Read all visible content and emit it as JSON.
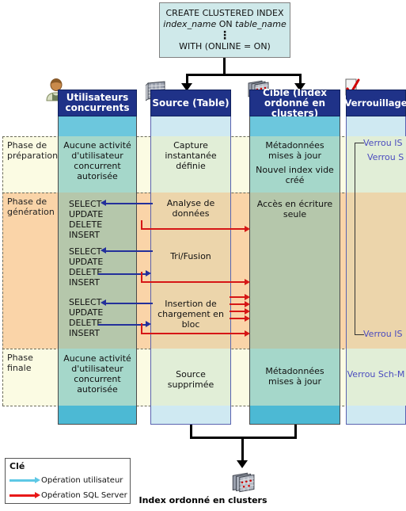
{
  "statement": {
    "line1": "CREATE CLUSTERED INDEX",
    "line2_a": "index_name",
    "line2_b": " ON ",
    "line2_c": "table_name",
    "ellipsis": "⋮",
    "line3": "WITH (ONLINE = ON)"
  },
  "columns": [
    {
      "key": "users",
      "header": "Utilisateurs\nconcurrents",
      "header_l1": "Utilisateurs",
      "header_l2": "concurrents",
      "icon": "user-icon"
    },
    {
      "key": "source",
      "header": "Source (Table)",
      "header_l1": "Source (Table)",
      "header_l2": "",
      "icon": "table-icon"
    },
    {
      "key": "target",
      "header": "Cible (Index ordonné en clusters)",
      "header_l1": "Cible (Index",
      "header_l2": "ordonné en clusters)",
      "icon": "index-icon"
    },
    {
      "key": "lock",
      "header": "Verrouillage",
      "header_l1": "Verrouillage",
      "header_l2": "",
      "icon": "checkmark-icon"
    }
  ],
  "phases": [
    {
      "key": "prep",
      "label_l1": "Phase de",
      "label_l2": "préparation",
      "color": "#fbfbe3"
    },
    {
      "key": "gen",
      "label_l1": "Phase de",
      "label_l2": "génération",
      "color": "#fad4a8"
    },
    {
      "key": "final",
      "label_l1": "Phase",
      "label_l2": "finale",
      "color": "#fbfbe3"
    }
  ],
  "cells": {
    "prep": {
      "users": "Aucune activité d'utilisateur concurrent autorisée",
      "source": "Capture instantanée définie",
      "target_l1": "Métadonnées mises à jour",
      "target_l2": "Nouvel index vide créé"
    },
    "gen": {
      "target": "Accès en écriture seule",
      "op1": "Analyse de données",
      "op2": "Tri/Fusion",
      "op3": "Insertion de chargement en bloc"
    },
    "final": {
      "users": "Aucune activité d'utilisateur concurrent autorisée",
      "source": "Source supprimée",
      "target": "Métadonnées mises à jour",
      "lock": "Verrou Sch-M"
    }
  },
  "user_ops": {
    "group1": [
      "SELECT",
      "UPDATE",
      "DELETE",
      "INSERT"
    ],
    "group2": [
      "SELECT",
      "UPDATE",
      "DELETE",
      "INSERT"
    ],
    "group3": [
      "SELECT",
      "UPDATE",
      "DELETE",
      "INSERT"
    ]
  },
  "locks": {
    "prep_top": "Verrou IS",
    "prep_second": "Verrou S",
    "gen_bottom": "Verrou IS",
    "final": "Verrou Sch-M"
  },
  "legend": {
    "title": "Clé",
    "items": [
      {
        "label": "Opération utilisateur",
        "color": "#5ec8e5"
      },
      {
        "label": "Opération SQL Server",
        "color": "#e81818"
      }
    ]
  },
  "bottom": {
    "caption": "Index ordonné en clusters",
    "icon": "index-icon"
  },
  "colors": {
    "header_blue": "#1f3288",
    "band_prep": "#fbfbe3",
    "band_gen": "#fad4a8",
    "band_final": "#fbfbe3",
    "user_op_arrow": "#23309b",
    "sql_op_arrow": "#d61616",
    "lock_text": "#4b4bbf"
  }
}
